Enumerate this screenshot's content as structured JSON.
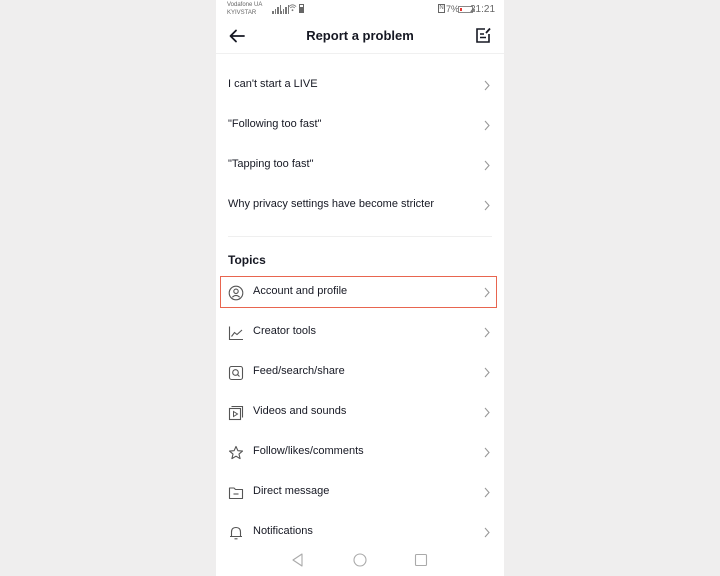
{
  "status_bar": {
    "carrier_line1": "Vodafone UA",
    "carrier_line2": "KYIVSTAR",
    "nfc": "N",
    "battery_percent": "7%",
    "time": "21:21",
    "battery_low_color": "#e53935"
  },
  "header": {
    "title": "Report a problem",
    "back_icon": "arrow-left-icon",
    "action_icon": "edit-note-icon"
  },
  "faq_items": [
    {
      "label": "I can't start a LIVE"
    },
    {
      "label": "\"Following too fast\""
    },
    {
      "label": "\"Tapping too fast\""
    },
    {
      "label": "Why privacy settings have become stricter"
    }
  ],
  "topics": {
    "heading": "Topics",
    "highlight_color": "#e8654f",
    "items": [
      {
        "label": "Account and profile",
        "icon": "user-circle-icon",
        "highlighted": true
      },
      {
        "label": "Creator tools",
        "icon": "chart-line-icon"
      },
      {
        "label": "Feed/search/share",
        "icon": "search-box-icon"
      },
      {
        "label": "Videos and sounds",
        "icon": "video-play-icon"
      },
      {
        "label": "Follow/likes/comments",
        "icon": "star-icon"
      },
      {
        "label": "Direct message",
        "icon": "folder-icon"
      },
      {
        "label": "Notifications",
        "icon": "bell-icon"
      }
    ]
  },
  "nav_bar": {
    "back": "triangle-back-icon",
    "home": "circle-home-icon",
    "recents": "square-recents-icon"
  }
}
